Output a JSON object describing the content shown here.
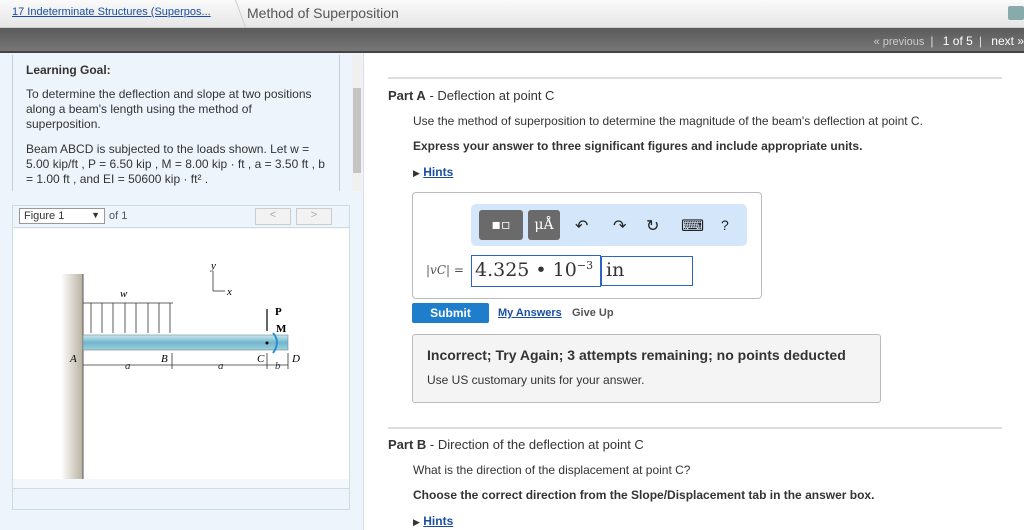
{
  "header": {
    "breadcrumb": "17 Indeterminate Structures (Superpos...",
    "title": "Method of Superposition"
  },
  "nav": {
    "previous": "« previous",
    "position": "1 of 5",
    "next": "next »"
  },
  "goal": {
    "heading": "Learning Goal:",
    "text": "To determine the deflection and slope at two positions along a beam's length using the method of superposition.",
    "problem": "Beam ABCD is subjected to the loads shown. Let w = 5.00 kip/ft , P = 6.50 kip , M = 8.00 kip · ft , a = 3.50 ft , b = 1.00 ft , and EI = 50600 kip · ft² ."
  },
  "figure": {
    "select": "Figure 1",
    "of": "of 1",
    "prev": "<",
    "next": ">",
    "labels": {
      "w": "w",
      "y": "y",
      "x": "x",
      "P": "P",
      "M": "M",
      "A": "A",
      "B": "B",
      "C": "C",
      "D": "D",
      "a": "a",
      "b": "b"
    }
  },
  "partA": {
    "label": "Part A",
    "title": "- Deflection at point C",
    "question": "Use the method of superposition to determine the magnitude of the beam's deflection at point C.",
    "instruction": "Express your answer to three significant figures and include appropriate units.",
    "hints": "Hints",
    "answer_label": "|vC| =",
    "value_mantissa": "4.325 • 10",
    "value_exp": "−3",
    "unit": "in",
    "toolbar": {
      "units": "μÅ",
      "undo": "↶",
      "redo": "↷",
      "reset": "↻",
      "keyboard": "⌨",
      "help": "?"
    },
    "submit": "Submit",
    "my_answers": "My Answers",
    "give_up": "Give Up",
    "feedback_title": "Incorrect; Try Again; 3 attempts remaining; no points deducted",
    "feedback_text": "Use US customary units for your answer."
  },
  "partB": {
    "label": "Part B",
    "title": "- Direction of the deflection at point C",
    "question": "What is the direction of the displacement at point C?",
    "instruction": "Choose the correct direction from the Slope/Displacement tab in the answer box.",
    "hints": "Hints"
  }
}
